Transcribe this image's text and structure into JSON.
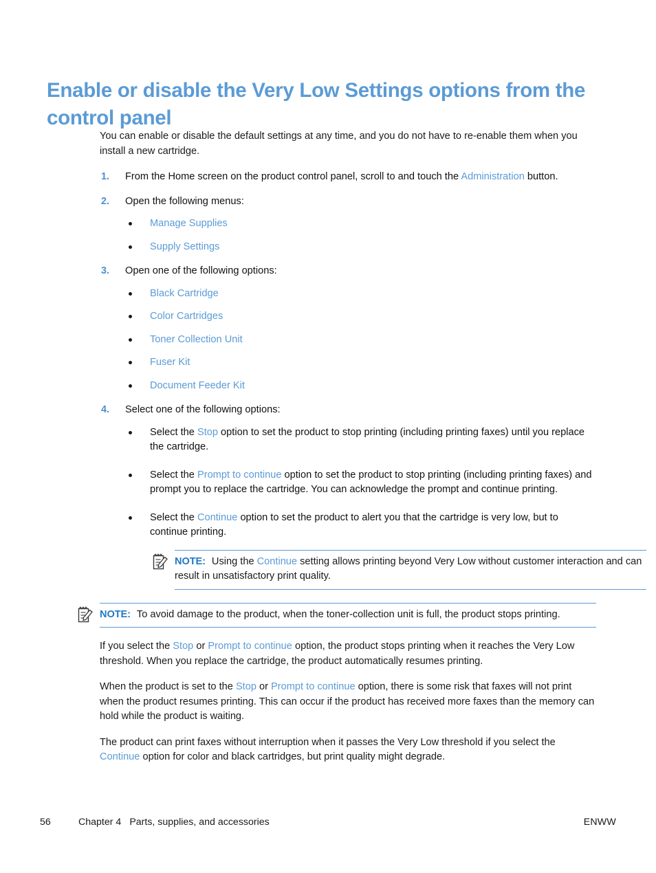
{
  "heading": "Enable or disable the Very Low Settings options from the control panel",
  "intro": "You can enable or disable the default settings at any time, and you do not have to re-enable them when you install a new cartridge.",
  "steps": [
    {
      "num": "1.",
      "text_before": "From the Home screen on the product control panel, scroll to and touch the ",
      "link": "Administration",
      "text_after": " button."
    },
    {
      "num": "2.",
      "text_before": "Open the following menus:",
      "link": "",
      "text_after": ""
    },
    {
      "num": "3.",
      "text_before": "Open one of the following options:",
      "link": "",
      "text_after": ""
    },
    {
      "num": "4.",
      "text_before": "Select one of the following options:",
      "link": "",
      "text_after": ""
    }
  ],
  "menus_list": [
    "Manage Supplies",
    "Supply Settings"
  ],
  "options_list": [
    "Black Cartridge",
    "Color Cartridges",
    "Toner Collection Unit",
    "Fuser Kit",
    "Document Feeder Kit"
  ],
  "select_options": [
    {
      "before": "Select the ",
      "link": "Stop",
      "after": " option to set the product to stop printing (including printing faxes) until you replace the cartridge."
    },
    {
      "before": "Select the ",
      "link": "Prompt to continue",
      "after": " option to set the product to stop printing (including printing faxes) and prompt you to replace the cartridge. You can acknowledge the prompt and continue printing."
    },
    {
      "before": "Select the ",
      "link": "Continue",
      "after": " option to set the product to alert you that the cartridge is very low, but to continue printing."
    }
  ],
  "note_1": {
    "icon": "note-icon",
    "label": "NOTE:",
    "before": "Using the ",
    "link": "Continue",
    "after": " setting allows printing beyond Very Low without customer interaction and can result in unsatisfactory print quality."
  },
  "note_2": {
    "icon": "note-icon",
    "label": "NOTE:",
    "before": "To avoid damage to the product, when the toner-collection unit is full, the product stops printing.",
    "link": "",
    "after": ""
  },
  "closing_paragraphs": [
    {
      "p1": "If you select the ",
      "l1": "Stop",
      "p2": " or ",
      "l2": "Prompt to continue",
      "p3": " option, the product stops printing when it reaches the Very Low threshold. When you replace the cartridge, the product automatically resumes printing."
    },
    {
      "p1": "When the product is set to the ",
      "l1": "Stop",
      "p2": " or ",
      "l2": "Prompt to continue",
      "p3": " option, there is some risk that faxes will not print when the product resumes printing. This can occur if the product has received more faxes than the memory can hold while the product is waiting."
    }
  ],
  "final_paragraph": {
    "p1": "The product can print faxes without interruption when it passes the Very Low threshold if you select the ",
    "l1": "Continue",
    "p2": " option for color and black cartridges, but print quality might degrade."
  },
  "footer": {
    "page_number": "56",
    "chapter_label": "Chapter 4",
    "chapter_title": "Parts, supplies, and accessories",
    "right_label": "ENWW"
  },
  "colors": {
    "heading_blue": "#5b9bd5",
    "link_blue": "#5b9bd5",
    "note_label_blue": "#2079c6",
    "rule_blue": "#5b9bd5",
    "body_text": "#1a1a1a"
  }
}
